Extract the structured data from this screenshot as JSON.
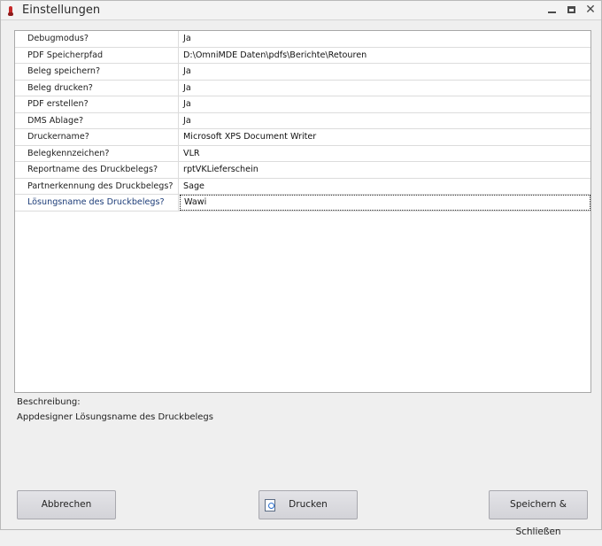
{
  "window": {
    "title": "Einstellungen"
  },
  "settings": [
    {
      "name": "Debugmodus?",
      "value": "Ja"
    },
    {
      "name": "PDF Speicherpfad",
      "value": "D:\\OmniMDE Daten\\pdfs\\Berichte\\Retouren"
    },
    {
      "name": "Beleg speichern?",
      "value": "Ja"
    },
    {
      "name": "Beleg drucken?",
      "value": "Ja"
    },
    {
      "name": "PDF erstellen?",
      "value": "Ja"
    },
    {
      "name": "DMS Ablage?",
      "value": "Ja"
    },
    {
      "name": "Druckername?",
      "value": "Microsoft XPS Document Writer"
    },
    {
      "name": "Belegkennzeichen?",
      "value": "VLR"
    },
    {
      "name": "Reportname des Druckbelegs?",
      "value": "rptVKLieferschein"
    },
    {
      "name": "Partnerkennung des Druckbelegs?",
      "value": "Sage"
    },
    {
      "name": "Lösungsname des Druckbelegs?",
      "value": "Wawi"
    }
  ],
  "description": {
    "label": "Beschreibung:",
    "text": "Appdesigner Lösungsname des Druckbelegs"
  },
  "buttons": {
    "cancel": "Abbrechen",
    "print": "Drucken",
    "save_close": "Speichern & Schließen"
  }
}
